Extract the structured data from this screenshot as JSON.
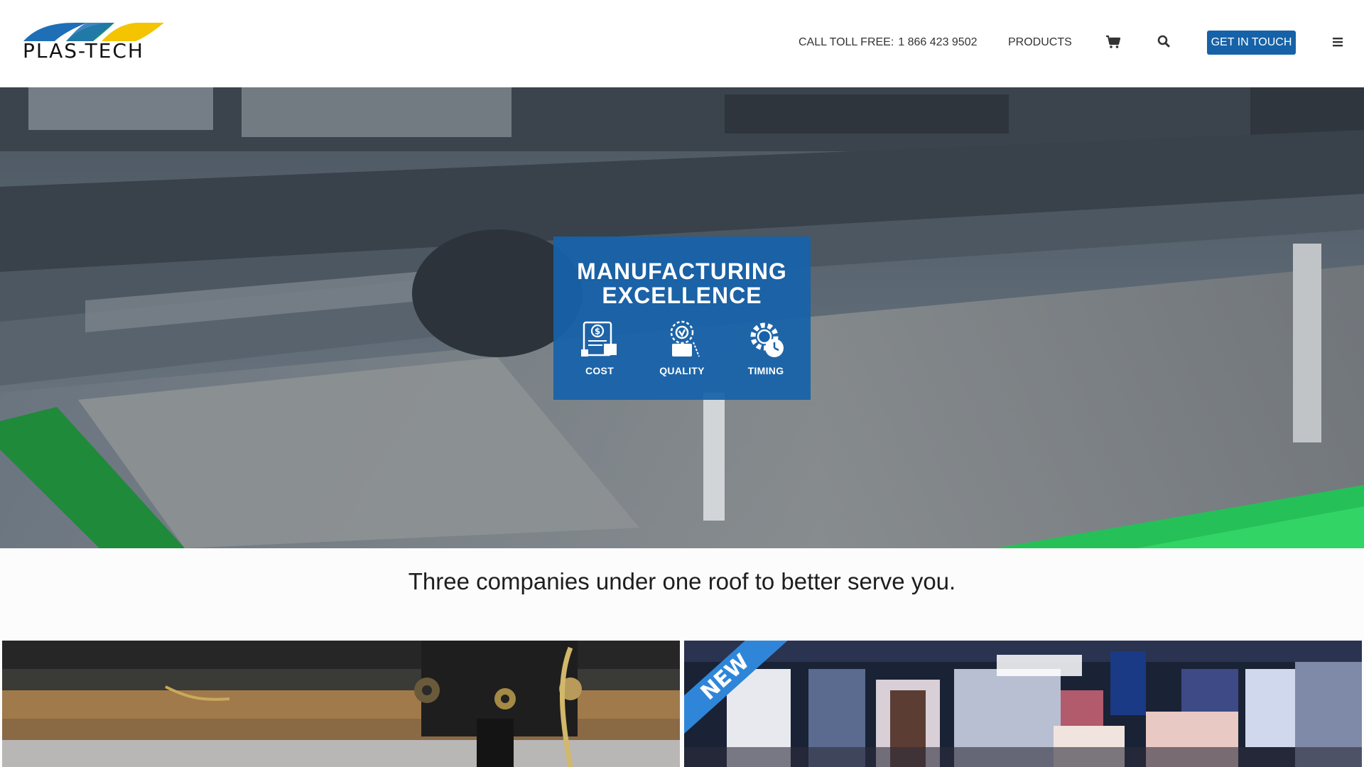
{
  "header": {
    "logo_text": "PLAS-TECH",
    "toll_label": "CALL TOLL FREE:",
    "toll_number": "1 866 423 9502",
    "products_label": "PRODUCTS",
    "cta_label": "GET IN TOUCH",
    "icons": [
      "cart-icon",
      "search-icon",
      "hamburger-menu-icon"
    ]
  },
  "hero": {
    "title_line1": "MANUFACTURING",
    "title_line2": "EXCELLENCE",
    "features": [
      {
        "label": "COST",
        "icon": "cost-icon"
      },
      {
        "label": "QUALITY",
        "icon": "quality-icon"
      },
      {
        "label": "TIMING",
        "icon": "timing-icon"
      }
    ]
  },
  "tagline": "Three companies under one roof to better serve you.",
  "cards": [
    {
      "badge": ""
    },
    {
      "badge": "NEW"
    }
  ],
  "colors": {
    "brand_blue": "#1662a8",
    "card_blue": "#1762aa",
    "ribbon_blue": "#2f86d8",
    "logo_green": "#2db34a",
    "logo_yellow": "#f5c400",
    "logo_blue": "#1f6fb6"
  }
}
